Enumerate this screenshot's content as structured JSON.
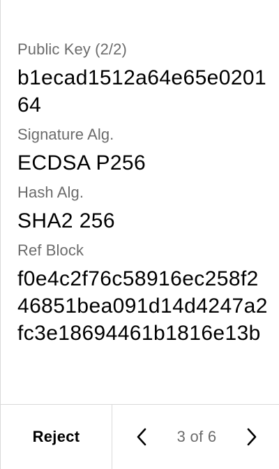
{
  "fields": [
    {
      "label": "Public Key (2/2)",
      "value": "b1ecad1512a64e65e020164"
    },
    {
      "label": "Signature Alg.",
      "value": "ECDSA P256"
    },
    {
      "label": "Hash Alg.",
      "value": "SHA2 256"
    },
    {
      "label": "Ref Block",
      "value": "f0e4c2f76c58916ec258f246851bea091d14d4247a2fc3e18694461b1816e13b"
    }
  ],
  "footer": {
    "reject_label": "Reject",
    "page_indicator": "3 of 6",
    "prev_icon": "chevron-left-icon",
    "next_icon": "chevron-right-icon"
  }
}
